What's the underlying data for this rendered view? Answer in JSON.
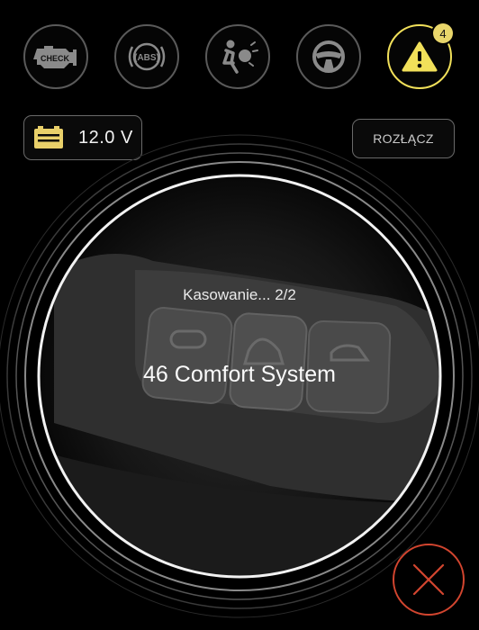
{
  "header": {
    "icons": [
      {
        "name": "check-engine-icon",
        "label": "CHECK"
      },
      {
        "name": "abs-icon",
        "label": "(ABS)"
      },
      {
        "name": "airbag-icon",
        "label": ""
      },
      {
        "name": "steering-wheel-icon",
        "label": ""
      },
      {
        "name": "warning-icon",
        "label": "",
        "active": true,
        "badge": "4"
      }
    ]
  },
  "battery": {
    "voltage": "12.0 V",
    "icon": "battery-icon"
  },
  "disconnect": {
    "label": "ROZŁĄCZ"
  },
  "progress": {
    "status": "Kasowanie... 2/2",
    "module": "46 Comfort System"
  },
  "colors": {
    "accent": "#f1e05a",
    "danger": "#d2452f",
    "background": "#000000"
  }
}
